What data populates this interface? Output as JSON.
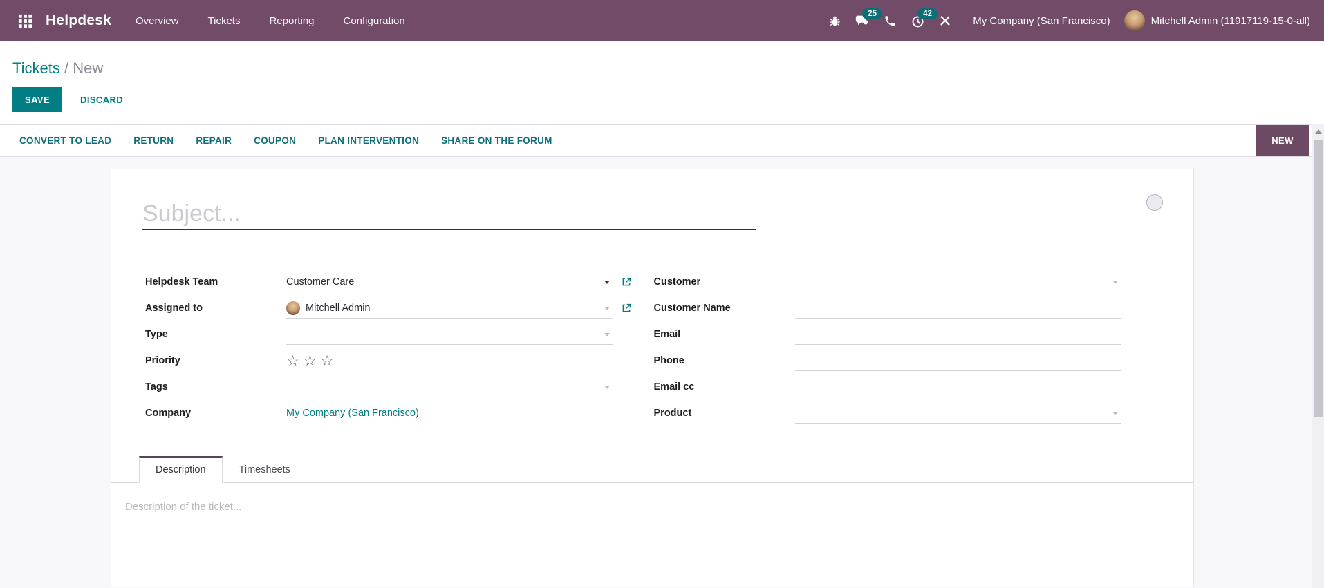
{
  "colors": {
    "navbar_bg": "#714B67",
    "accent_teal": "#017E84",
    "badge_teal": "#0C6F75",
    "stage_badge_bg": "#6D4A64",
    "tab_accent": "#5F4157"
  },
  "navbar": {
    "app_name": "Helpdesk",
    "menus": [
      {
        "label": "Overview"
      },
      {
        "label": "Tickets"
      },
      {
        "label": "Reporting"
      },
      {
        "label": "Configuration"
      }
    ],
    "systray": {
      "messages_badge": "25",
      "activities_badge": "42",
      "company_switcher": "My Company (San Francisco)",
      "user_name": "Mitchell Admin (11917119-15-0-all)"
    }
  },
  "breadcrumb": {
    "parent": "Tickets",
    "separator": " / ",
    "current": "New"
  },
  "control_panel": {
    "save_label": "SAVE",
    "discard_label": "DISCARD"
  },
  "statusbar": {
    "actions": [
      "CONVERT TO LEAD",
      "RETURN",
      "REPAIR",
      "COUPON",
      "PLAN INTERVENTION",
      "SHARE ON THE FORUM"
    ],
    "stage": "NEW"
  },
  "form": {
    "subject_placeholder": "Subject...",
    "fields": {
      "helpdesk_team": {
        "label": "Helpdesk Team",
        "value": "Customer Care"
      },
      "assigned_to": {
        "label": "Assigned to",
        "value": "Mitchell Admin"
      },
      "type": {
        "label": "Type",
        "value": ""
      },
      "priority": {
        "label": "Priority",
        "stars": 3
      },
      "tags": {
        "label": "Tags",
        "value": ""
      },
      "company": {
        "label": "Company",
        "value": "My Company (San Francisco)"
      },
      "customer": {
        "label": "Customer",
        "value": ""
      },
      "customer_name": {
        "label": "Customer Name",
        "value": ""
      },
      "email": {
        "label": "Email",
        "value": ""
      },
      "phone": {
        "label": "Phone",
        "value": ""
      },
      "email_cc": {
        "label": "Email cc",
        "value": ""
      },
      "product": {
        "label": "Product",
        "value": ""
      }
    },
    "tabs": [
      {
        "label": "Description",
        "active": true
      },
      {
        "label": "Timesheets",
        "active": false
      }
    ],
    "description_placeholder": "Description of the ticket..."
  },
  "icons": {
    "apps": "grid-3x3",
    "bug": "bug",
    "messages": "chat-bubbles",
    "calls": "phone",
    "activities": "clock",
    "tools": "wrench-screwdriver",
    "dropdown": "caret-down",
    "external_link": "external-link-box-arrow",
    "priority_star": "☆",
    "kanban_state": "circle",
    "scroll_up": "triangle-up"
  }
}
